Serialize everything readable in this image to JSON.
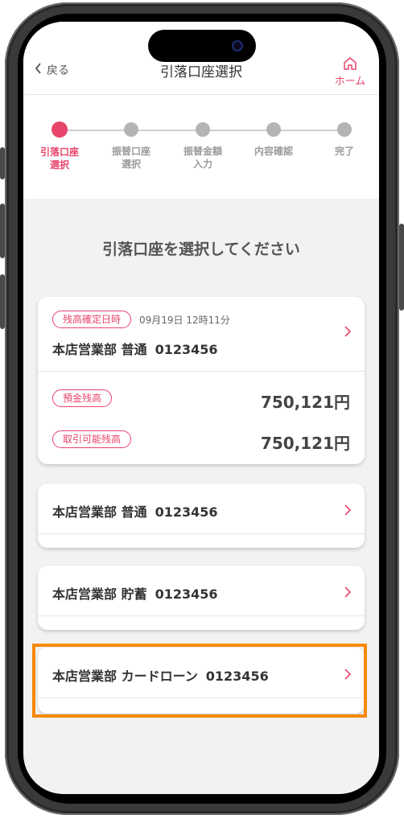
{
  "header": {
    "back_label": "戻る",
    "title": "引落口座選択",
    "home_label": "ホーム"
  },
  "steps": [
    {
      "label": "引落口座\n選択",
      "active": true
    },
    {
      "label": "振替口座\n選択",
      "active": false
    },
    {
      "label": "振替金額\n入力",
      "active": false
    },
    {
      "label": "内容確認",
      "active": false
    },
    {
      "label": "完了",
      "active": false
    }
  ],
  "prompt": "引落口座を選択してください",
  "accounts": [
    {
      "tag_balance_date": "残高確定日時",
      "balance_datetime": "09月19日 12時11分",
      "name": "本店営業部 普通",
      "number": "0123456",
      "deposit_label": "預金残高",
      "deposit_value": "750,121円",
      "available_label": "取引可能残高",
      "available_value": "750,121円"
    },
    {
      "name": "本店営業部 普通",
      "number": "0123456"
    },
    {
      "name": "本店営業部 貯蓄",
      "number": "0123456"
    },
    {
      "name": "本店営業部 カードローン",
      "number": "0123456"
    }
  ],
  "colors": {
    "accent": "#e8456b",
    "highlight": "#f7890a"
  }
}
